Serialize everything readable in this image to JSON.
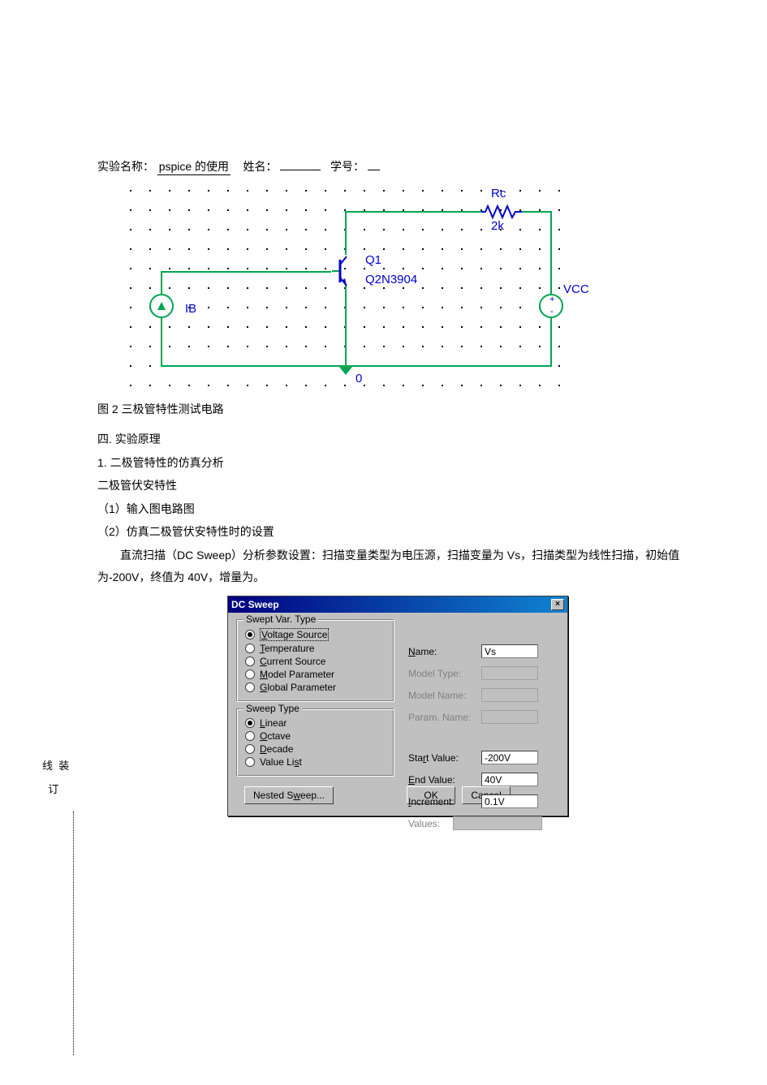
{
  "header": {
    "lab_name_label": "实验名称：",
    "lab_name_value": "pspice 的使用",
    "name_label": "姓名：",
    "id_label": "学号："
  },
  "circuit": {
    "rc_label": "Rc",
    "rc_value": "2k",
    "q1_label": "Q1",
    "q1_model": "Q2N3904",
    "ib_label": "IB",
    "vcc_label": "VCC",
    "gnd_label": "0"
  },
  "caption": "图 2 三极管特性测试电路",
  "section": {
    "title": "四. 实验原理",
    "sub1": "1. 二极管特性的仿真分析",
    "sub2": "二极管伏安特性",
    "step1": "（1）输入图电路图",
    "step2": "（2）仿真二极管伏安特性时的设置",
    "desc": "直流扫描（DC Sweep）分析参数设置：扫描变量类型为电压源，扫描变量为 Vs，扫描类型为线性扫描，初始值为-200V，终值为 40V，增量为。"
  },
  "dialog": {
    "title": "DC Sweep",
    "close": "×",
    "swept_var_legend": "Swept Var. Type",
    "options_var": {
      "voltage": "Voltage Source",
      "temperature": "Temperature",
      "current": "Current Source",
      "model": "Model Parameter",
      "global": "Global Parameter"
    },
    "sweep_type_legend": "Sweep Type",
    "options_sweep": {
      "linear": "Linear",
      "octave": "Octave",
      "decade": "Decade",
      "valuelist": "Value List"
    },
    "fields": {
      "name_label": "Name:",
      "name_value": "Vs",
      "model_type_label": "Model Type:",
      "model_name_label": "Model Name:",
      "param_name_label": "Param. Name:",
      "start_label": "Start Value:",
      "start_value": "-200V",
      "end_label": "End Value:",
      "end_value": "40V",
      "inc_label": "Increment:",
      "inc_value": "0.1V",
      "values_label": "Values:"
    },
    "buttons": {
      "nested": "Nested Sweep...",
      "ok": "OK",
      "cancel": "Cancel"
    }
  },
  "side": {
    "zhuang": "装",
    "xian": "线",
    "ding": "订"
  }
}
